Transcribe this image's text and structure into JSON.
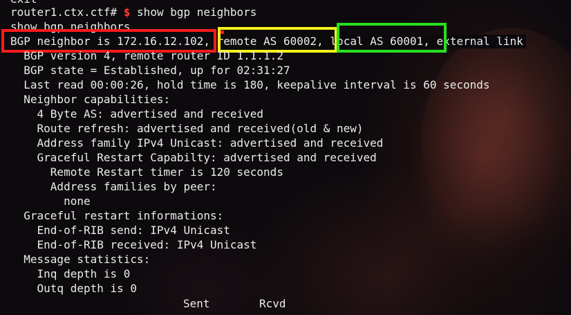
{
  "terminal": {
    "partial_top_line": "exit",
    "prompt": "router1.ctx.ctf#",
    "prompt_sign": "$",
    "command": "show bgp neighbors",
    "echo_command": "show bgp neighbors",
    "neighbor_line": {
      "neighbor": "BGP neighbor is 172.16.12.102",
      "sep1": ",",
      "remote_as": "remote AS 60002",
      "sep2": ",",
      "local_as": "local AS 60001",
      "rest": ", external link"
    },
    "lines": [
      "  BGP version 4, remote router ID 1.1.1.2",
      "  BGP state = Established, up for 02:31:27",
      "  Last read 00:00:26, hold time is 180, keepalive interval is 60 seconds",
      "  Neighbor capabilities:",
      "    4 Byte AS: advertised and received",
      "    Route refresh: advertised and received(old & new)",
      "    Address family IPv4 Unicast: advertised and received",
      "    Graceful Restart Capabilty: advertised and received",
      "      Remote Restart timer is 120 seconds",
      "      Address families by peer:",
      "        none",
      "  Graceful restart informations:",
      "    End-of-RIB send: IPv4 Unicast",
      "    End-of-RIB received: IPv4 Unicast",
      "  Message statistics:",
      "    Inq depth is 0",
      "    Outq depth is 0"
    ],
    "stats_columns": {
      "sent": "Sent",
      "rcvd": "Rcvd"
    }
  },
  "highlight_colors": {
    "neighbor_box": "#ff1b1b",
    "remote_as_box": "#f5f21c",
    "local_as_box": "#27e11e",
    "prompt_sign": "#ff3b3b"
  }
}
